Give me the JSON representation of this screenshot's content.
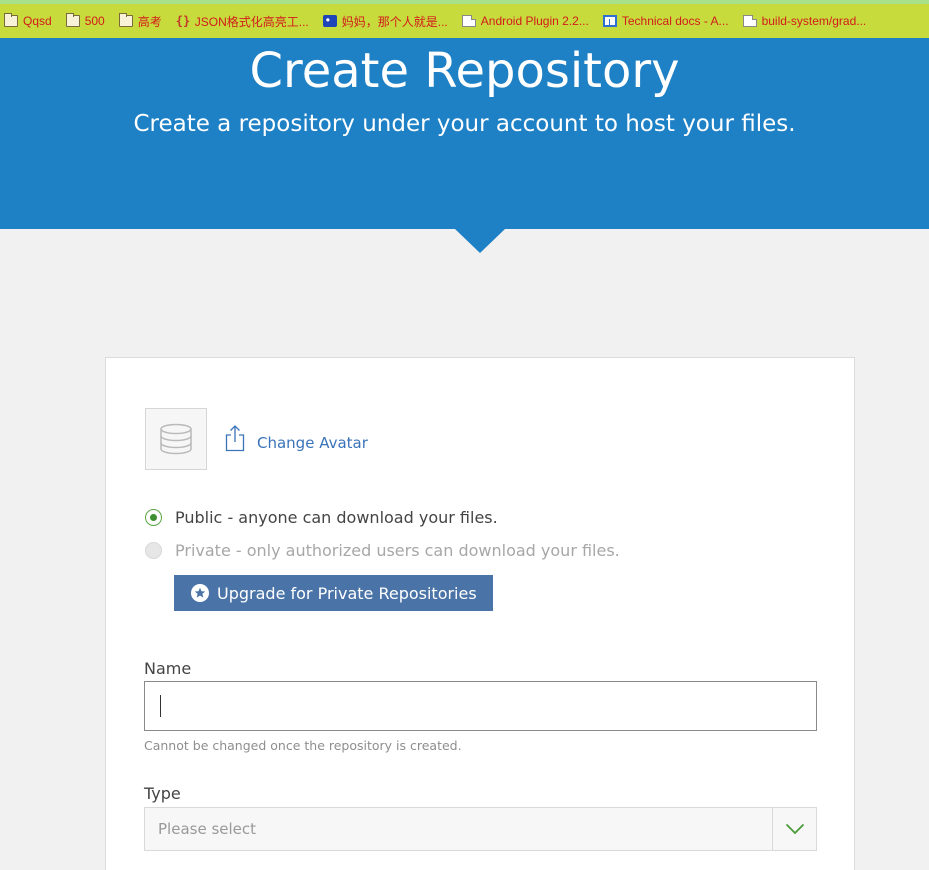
{
  "bookmarks": [
    {
      "label": "Qqsd",
      "icon": "folder-icon"
    },
    {
      "label": "500",
      "icon": "folder-icon"
    },
    {
      "label": "高考",
      "icon": "folder-icon"
    },
    {
      "label": "JSON格式化高亮工...",
      "icon": "braces-icon"
    },
    {
      "label": "妈妈，那个人就是...",
      "icon": "paw-icon"
    },
    {
      "label": "Android Plugin 2.2...",
      "icon": "document-icon"
    },
    {
      "label": "Technical docs - A...",
      "icon": "window-icon"
    },
    {
      "label": "build-system/grad...",
      "icon": "document-icon"
    }
  ],
  "hero": {
    "title": "Create Repository",
    "subtitle": "Create a repository under your account to host your files."
  },
  "avatar": {
    "change_label": "Change Avatar"
  },
  "visibility": {
    "public_label": "Public - anyone can download your files.",
    "private_label": "Private - only authorized users can download your files.",
    "selected": "public",
    "upgrade_label": "Upgrade for Private Repositories"
  },
  "form": {
    "name_label": "Name",
    "name_value": "",
    "name_hint": "Cannot be changed once the repository is created.",
    "type_label": "Type",
    "type_placeholder": "Please select"
  },
  "colors": {
    "header": "#1e80c5",
    "accent_link": "#3b73b9",
    "button": "#4a74a8",
    "radio_selected": "#3d8f2f",
    "bookmark_bar": "#c7dc3c",
    "bookmark_text": "#d21b1b"
  }
}
